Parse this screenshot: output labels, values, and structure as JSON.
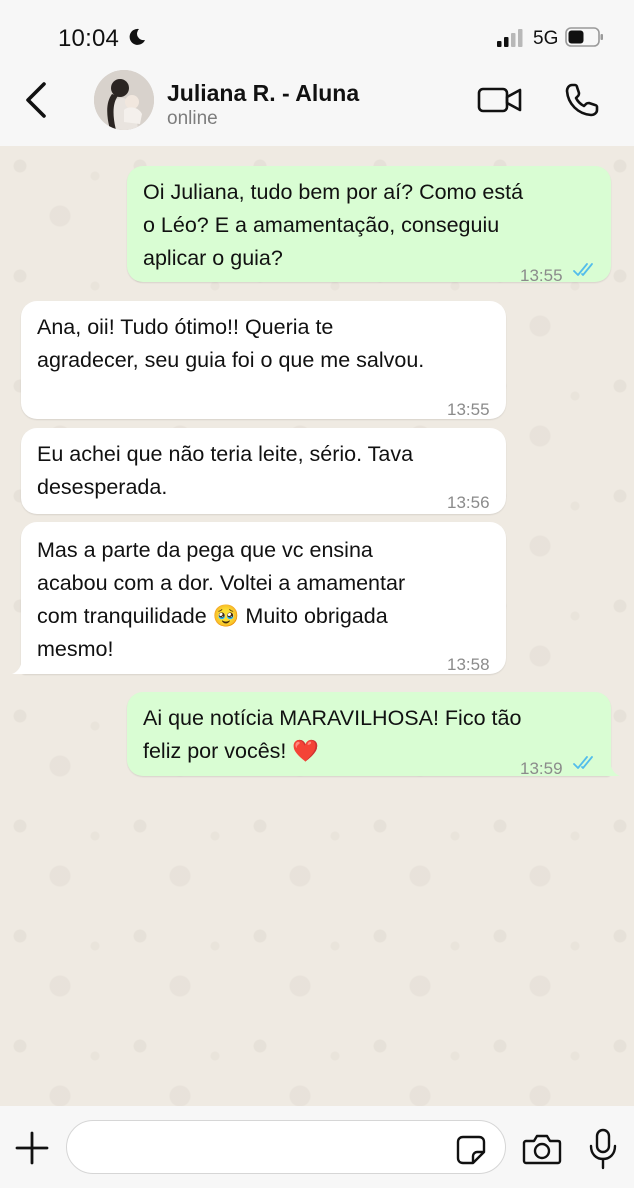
{
  "status_bar": {
    "time": "10:04",
    "network": "5G",
    "icons": [
      "moon-icon",
      "signal-icon",
      "battery-icon"
    ]
  },
  "header": {
    "contact_name": "Juliana R. - Aluna",
    "contact_status": "online",
    "icons": [
      "back-arrow-icon",
      "avatar",
      "video-camera-icon",
      "phone-icon"
    ]
  },
  "messages": [
    {
      "direction": "out",
      "text": "Oi Juliana, tudo bem por aí? Como está\no Léo? E a amamentação, conseguiu\naplicar o guia?",
      "time": "13:55",
      "read": true
    },
    {
      "direction": "in",
      "text": "Ana, oii! Tudo ótimo!! Queria te\nagradecer, seu guia foi o que me salvou.",
      "time": "13:55"
    },
    {
      "direction": "in",
      "text": "Eu achei que não teria leite, sério. Tava\ndesesperada.",
      "time": "13:56"
    },
    {
      "direction": "in",
      "text": "Mas a parte da pega que vc ensina\nacabou com a dor. Voltei a amamentar\ncom tranquilidade 🥹 Muito obrigada\nmesmo!",
      "time": "13:58"
    },
    {
      "direction": "out",
      "text": "Ai que notícia MARAVILHOSA! Fico tão\nfeliz por vocês! ❤️",
      "time": "13:59",
      "read": true
    }
  ],
  "input_bar": {
    "placeholder": "",
    "icons": [
      "plus-icon",
      "sticker-icon",
      "camera-icon",
      "microphone-icon"
    ]
  },
  "colors": {
    "outgoing_bubble": "#d9fdd3",
    "incoming_bubble": "#ffffff",
    "read_ticks": "#53bdeb",
    "chat_background": "#efeae2"
  }
}
